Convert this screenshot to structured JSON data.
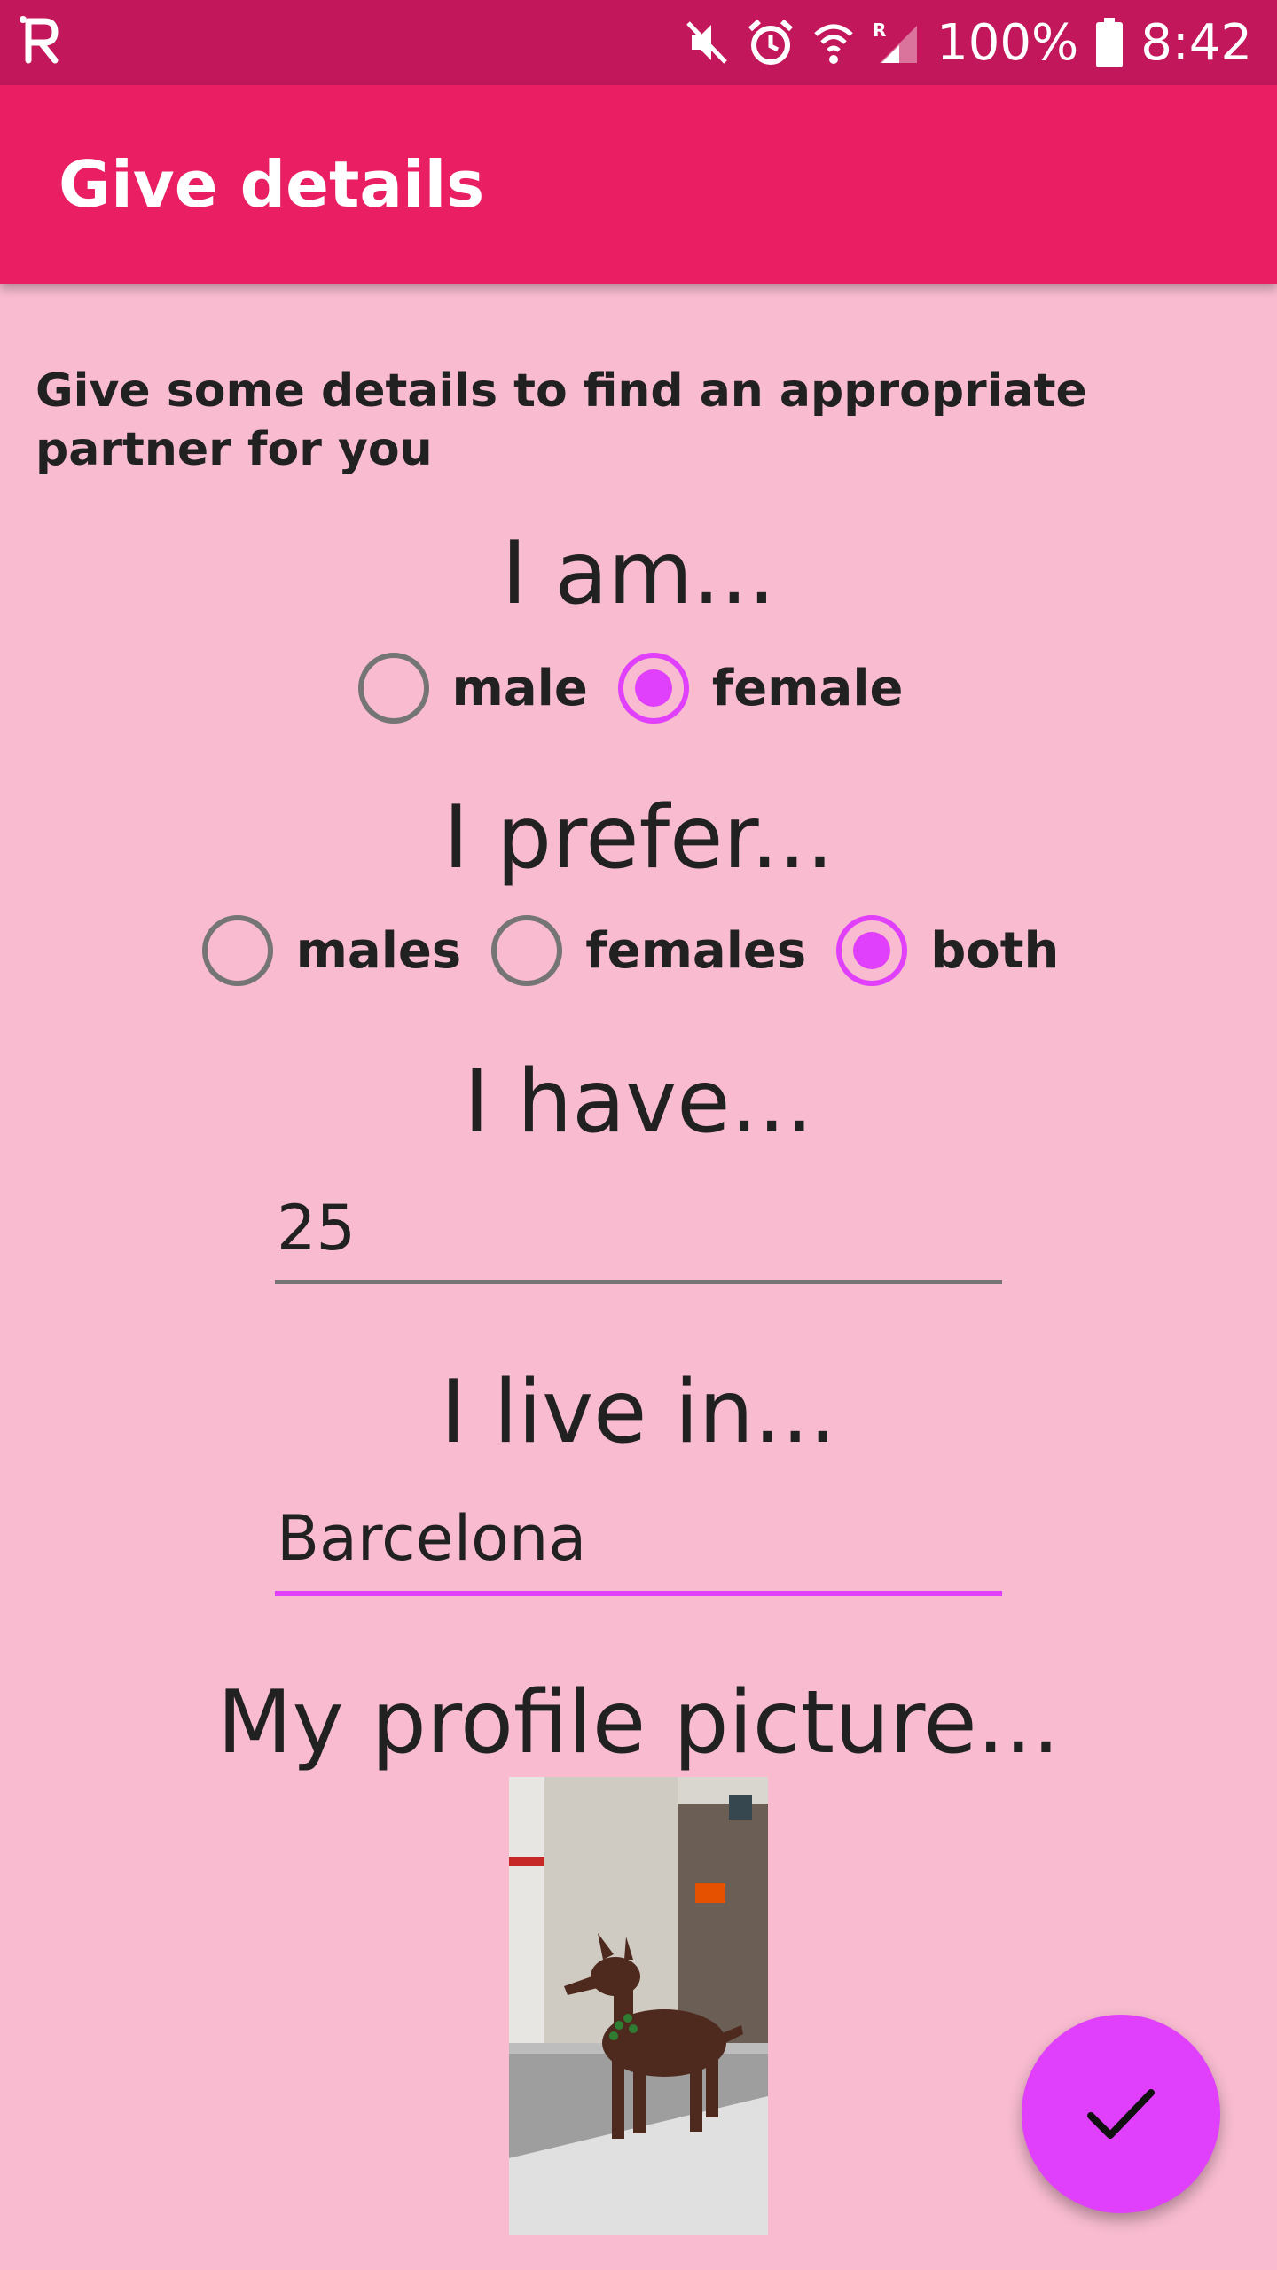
{
  "status_bar": {
    "battery": "100%",
    "time": "8:42",
    "icons": [
      "app-logo-icon",
      "mute-icon",
      "alarm-icon",
      "wifi-icon",
      "signal-icon",
      "battery-icon"
    ]
  },
  "app_bar": {
    "title": "Give details"
  },
  "intro": "Give some details to find an appropriate partner for you",
  "gender": {
    "heading": "I am...",
    "options": [
      {
        "label": "male",
        "checked": false
      },
      {
        "label": "female",
        "checked": true
      }
    ]
  },
  "preference": {
    "heading": "I prefer...",
    "options": [
      {
        "label": "males",
        "checked": false
      },
      {
        "label": "females",
        "checked": false
      },
      {
        "label": "both",
        "checked": true
      }
    ]
  },
  "age": {
    "heading": "I have...",
    "value": "25"
  },
  "location": {
    "heading": "I live in...",
    "value": "Barcelona"
  },
  "picture": {
    "heading": "My profile picture..."
  },
  "fab": {
    "icon": "check-icon"
  },
  "colors": {
    "status_bar": "#c2185b",
    "app_bar": "#e91e63",
    "background": "#f8bbd0",
    "accent": "#e040fb"
  }
}
